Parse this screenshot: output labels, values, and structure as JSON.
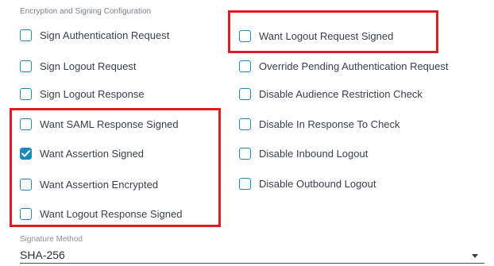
{
  "section_title": "Encryption and Signing Configuration",
  "colors": {
    "checkbox_accent": "#1f8ab8",
    "highlight_border": "#e11b22"
  },
  "left_column": [
    {
      "label": "Sign Authentication Request",
      "checked": false
    },
    {
      "label": "Sign Logout Request",
      "checked": false
    },
    {
      "label": "Sign Logout Response",
      "checked": false
    },
    {
      "label": "Want SAML Response Signed",
      "checked": false
    },
    {
      "label": "Want Assertion Signed",
      "checked": true
    },
    {
      "label": "Want Assertion Encrypted",
      "checked": false
    },
    {
      "label": "Want Logout Response Signed",
      "checked": false
    }
  ],
  "right_column": [
    {
      "label": "Want Logout Request Signed",
      "checked": false
    },
    {
      "label": "Override Pending Authentication Request",
      "checked": false
    },
    {
      "label": "Disable Audience Restriction Check",
      "checked": false
    },
    {
      "label": "Disable In Response To Check",
      "checked": false
    },
    {
      "label": "Disable Inbound Logout",
      "checked": false
    },
    {
      "label": "Disable Outbound Logout",
      "checked": false
    }
  ],
  "signature_method": {
    "label": "Signature Method",
    "value": "SHA-256",
    "icon": "caret-down-icon"
  }
}
